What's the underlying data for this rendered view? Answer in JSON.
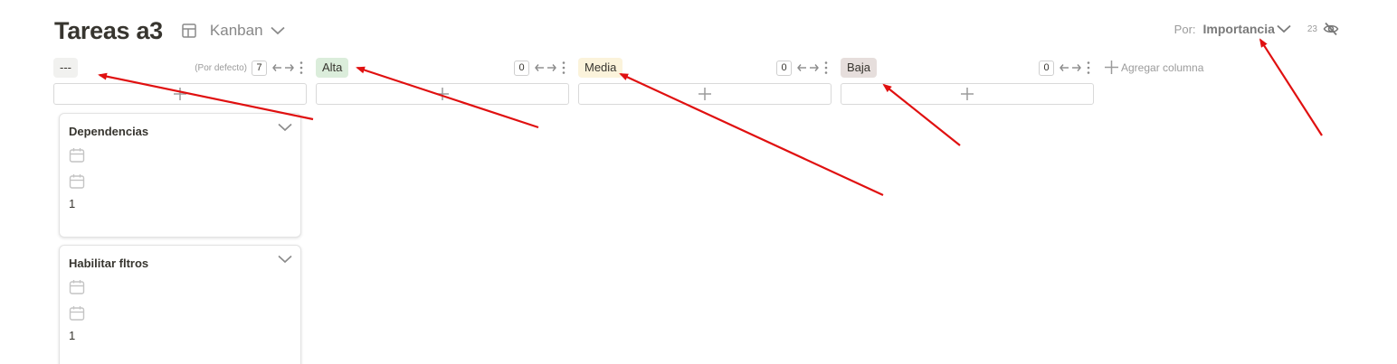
{
  "header": {
    "title": "Tareas a3",
    "view_name": "Kanban",
    "view_icon": "board-layout-icon"
  },
  "group_by": {
    "label": "Por:",
    "value": "Importancia",
    "hidden_count": "23",
    "hidden_icon": "eye-off-icon"
  },
  "columns": [
    {
      "label": "---",
      "note": "(Por defecto)",
      "count": "7",
      "color": "#f1f1ef"
    },
    {
      "label": "Alta",
      "note": "",
      "count": "0",
      "color": "#dbeddb"
    },
    {
      "label": "Media",
      "note": "",
      "count": "0",
      "color": "#fbf3db"
    },
    {
      "label": "Baja",
      "note": "",
      "count": "0",
      "color": "#e6dedc"
    }
  ],
  "add_column_label": "Agregar columna",
  "cards": [
    {
      "title": "Dependencias",
      "value": "1"
    },
    {
      "title": "Habilitar fltros",
      "value": "1"
    }
  ],
  "annotation_color": "#e01010"
}
